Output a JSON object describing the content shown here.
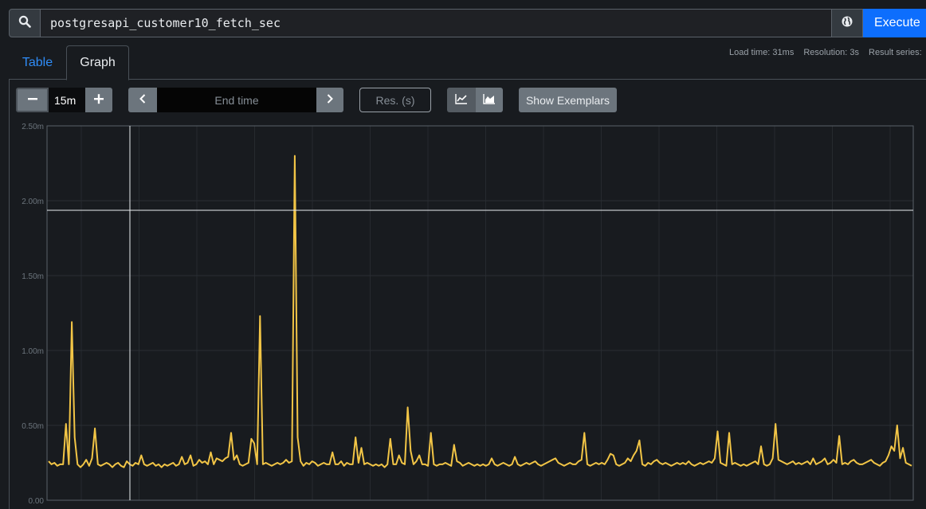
{
  "query": {
    "value": "postgresapi_customer10_fetch_sec",
    "execute_label": "Execute"
  },
  "tabs": [
    {
      "label": "Table",
      "active": false
    },
    {
      "label": "Graph",
      "active": true
    }
  ],
  "stats": {
    "load_time": "Load time: 31ms",
    "resolution": "Resolution: 3s",
    "result_series": "Result series:"
  },
  "controls": {
    "range": "15m",
    "end_time_placeholder": "End time",
    "res_placeholder": "Res. (s)",
    "exemplars_label": "Show Exemplars"
  },
  "icons": {
    "search": "search-icon",
    "globe": "globe-icon",
    "minus": "minus-icon",
    "plus": "plus-icon",
    "prev": "chevron-left-icon",
    "next": "chevron-right-icon",
    "line": "line-chart-icon",
    "stacked": "stacked-chart-icon"
  },
  "colors": {
    "series": "#f2c546",
    "accent": "#0d6efd",
    "background": "#181b1f"
  },
  "chart_data": {
    "type": "line",
    "title": "",
    "xlabel": "",
    "ylabel": "",
    "ylim": [
      0,
      2.5
    ],
    "yticks": [
      {
        "value": 0,
        "label": "0.00"
      },
      {
        "value": 0.5,
        "label": "0.50m"
      },
      {
        "value": 1.0,
        "label": "1.00m"
      },
      {
        "value": 1.5,
        "label": "1.50m"
      },
      {
        "value": 2.0,
        "label": "2.00m"
      },
      {
        "value": 2.5,
        "label": "2.50m"
      }
    ],
    "grid": true,
    "legend": "none",
    "series": [
      {
        "values": [
          0.26,
          0.24,
          0.25,
          0.23,
          0.24,
          0.24,
          0.51,
          0.24,
          1.19,
          0.42,
          0.24,
          0.22,
          0.24,
          0.27,
          0.23,
          0.28,
          0.48,
          0.24,
          0.23,
          0.24,
          0.25,
          0.24,
          0.22,
          0.24,
          0.25,
          0.23,
          0.22,
          0.26,
          0.24,
          0.23,
          0.25,
          0.24,
          0.3,
          0.24,
          0.23,
          0.24,
          0.25,
          0.23,
          0.24,
          0.22,
          0.24,
          0.23,
          0.24,
          0.25,
          0.23,
          0.24,
          0.29,
          0.24,
          0.25,
          0.3,
          0.23,
          0.24,
          0.27,
          0.25,
          0.26,
          0.24,
          0.32,
          0.24,
          0.28,
          0.27,
          0.26,
          0.28,
          0.29,
          0.45,
          0.27,
          0.3,
          0.24,
          0.23,
          0.24,
          0.25,
          0.41,
          0.38,
          0.24,
          1.23,
          0.24,
          0.25,
          0.24,
          0.23,
          0.24,
          0.25,
          0.24,
          0.25,
          0.27,
          0.25,
          0.26,
          2.3,
          0.42,
          0.26,
          0.23,
          0.25,
          0.24,
          0.26,
          0.25,
          0.23,
          0.24,
          0.25,
          0.24,
          0.24,
          0.32,
          0.24,
          0.24,
          0.26,
          0.23,
          0.25,
          0.24,
          0.24,
          0.42,
          0.25,
          0.35,
          0.24,
          0.25,
          0.24,
          0.23,
          0.24,
          0.23,
          0.24,
          0.22,
          0.24,
          0.41,
          0.24,
          0.24,
          0.3,
          0.25,
          0.24,
          0.62,
          0.33,
          0.24,
          0.26,
          0.3,
          0.24,
          0.24,
          0.23,
          0.45,
          0.24,
          0.23,
          0.24,
          0.24,
          0.25,
          0.24,
          0.23,
          0.37,
          0.26,
          0.25,
          0.23,
          0.24,
          0.25,
          0.24,
          0.23,
          0.24,
          0.23,
          0.24,
          0.23,
          0.24,
          0.28,
          0.24,
          0.23,
          0.24,
          0.25,
          0.24,
          0.23,
          0.24,
          0.29,
          0.24,
          0.23,
          0.24,
          0.25,
          0.24,
          0.25,
          0.26,
          0.24,
          0.23,
          0.24,
          0.25,
          0.26,
          0.27,
          0.28,
          0.25,
          0.24,
          0.23,
          0.24,
          0.25,
          0.24,
          0.24,
          0.26,
          0.27,
          0.45,
          0.24,
          0.23,
          0.24,
          0.25,
          0.24,
          0.25,
          0.24,
          0.27,
          0.31,
          0.3,
          0.24,
          0.23,
          0.24,
          0.25,
          0.28,
          0.26,
          0.3,
          0.33,
          0.4,
          0.24,
          0.23,
          0.25,
          0.24,
          0.26,
          0.27,
          0.25,
          0.24,
          0.25,
          0.24,
          0.23,
          0.24,
          0.25,
          0.24,
          0.25,
          0.24,
          0.26,
          0.24,
          0.23,
          0.24,
          0.25,
          0.24,
          0.25,
          0.26,
          0.25,
          0.28,
          0.46,
          0.25,
          0.24,
          0.23,
          0.45,
          0.24,
          0.25,
          0.24,
          0.23,
          0.24,
          0.23,
          0.24,
          0.25,
          0.26,
          0.24,
          0.36,
          0.24,
          0.23,
          0.24,
          0.28,
          0.51,
          0.27,
          0.26,
          0.25,
          0.24,
          0.25,
          0.26,
          0.24,
          0.25,
          0.24,
          0.25,
          0.26,
          0.24,
          0.28,
          0.24,
          0.25,
          0.26,
          0.28,
          0.24,
          0.25,
          0.27,
          0.25,
          0.43,
          0.24,
          0.25,
          0.24,
          0.26,
          0.27,
          0.25,
          0.24,
          0.24,
          0.25,
          0.26,
          0.27,
          0.25,
          0.24,
          0.23,
          0.25,
          0.26,
          0.3,
          0.36,
          0.33,
          0.5,
          0.28,
          0.35,
          0.25,
          0.24,
          0.23
        ]
      }
    ]
  }
}
